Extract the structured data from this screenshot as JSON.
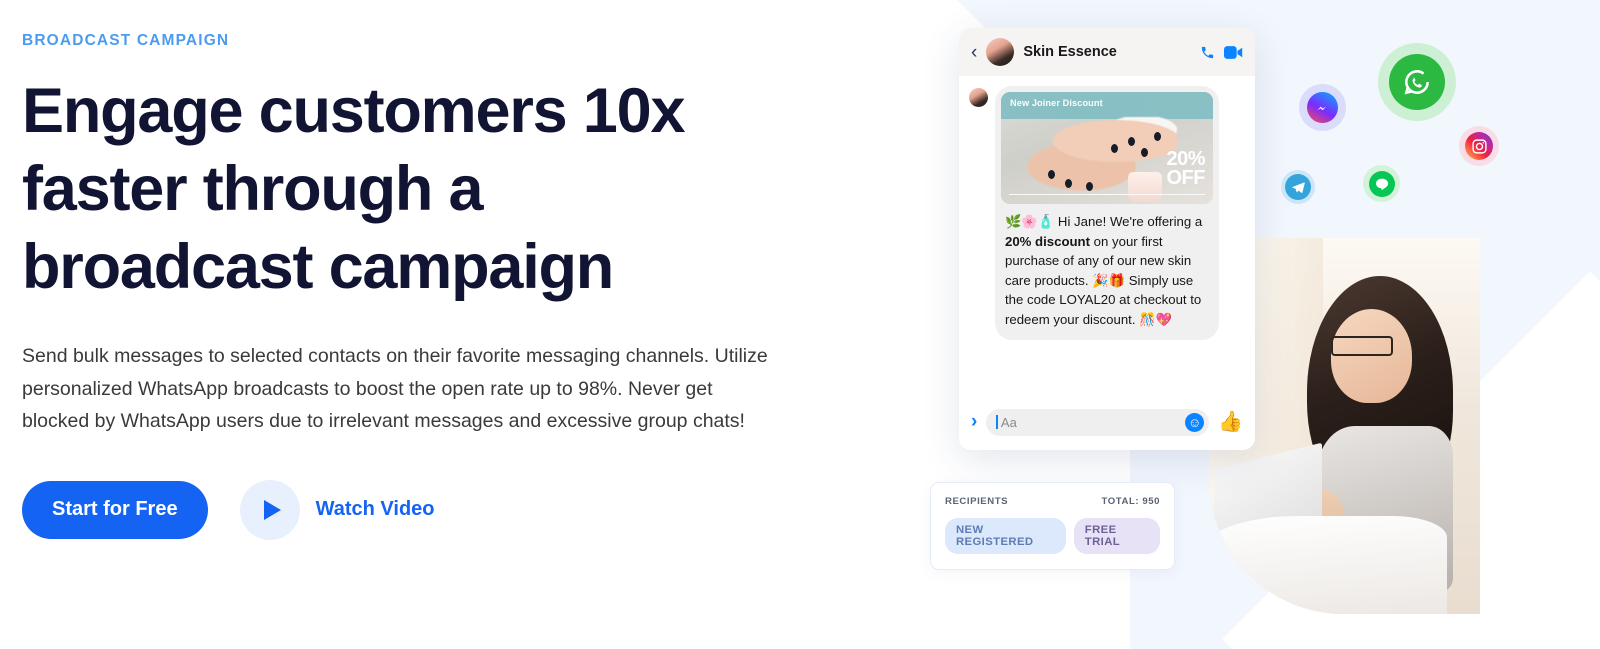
{
  "hero": {
    "eyebrow": "BROADCAST CAMPAIGN",
    "headline": "Engage customers 10x faster through a broadcast campaign",
    "subcopy": "Send bulk messages to selected contacts on their favorite messaging channels. Utilize personalized WhatsApp broadcasts to boost the open rate up to 98%. Never get blocked by WhatsApp users due to irrelevant messages and excessive group chats!",
    "primary_cta": "Start for Free",
    "video_cta": "Watch Video"
  },
  "chat": {
    "contact_name": "Skin Essence",
    "promo_banner_label": "New Joiner Discount",
    "promo_discount": "20%",
    "promo_off": "OFF",
    "message_prefix": "🌿🌸🧴 Hi Jane! We're offering a ",
    "message_bold": "20% discount",
    "message_rest": " on your first purchase of any of our new skin care products. 🎉🎁 Simply use the code LOYAL20 at checkout to redeem your discount. 🎊💖",
    "input_placeholder": "Aa"
  },
  "recipients": {
    "label": "RECIPIENTS",
    "total": "TOTAL: 950",
    "tags": [
      "NEW REGISTERED",
      "FREE TRIAL"
    ]
  },
  "social": {
    "whatsapp": "WhatsApp",
    "messenger": "Messenger",
    "instagram": "Instagram",
    "line": "LINE",
    "telegram": "Telegram"
  },
  "colors": {
    "accent_blue": "#1463F3",
    "eyebrow_blue": "#4D9BF0",
    "headline_navy": "#111432",
    "panel_bg": "#F2F6FD",
    "whatsapp_green": "#2BB941"
  }
}
